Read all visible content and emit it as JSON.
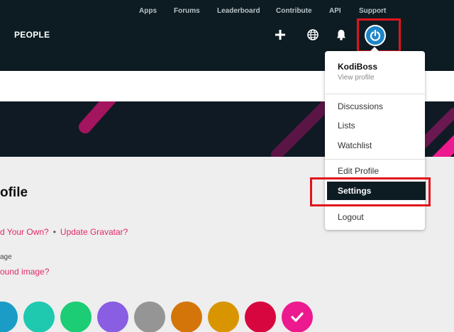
{
  "nav": {
    "links": [
      "Apps",
      "Forums",
      "Leaderboard",
      "Contribute",
      "API",
      "Support"
    ],
    "brand": "PEOPLE",
    "icons": [
      "plus-icon",
      "globe-icon",
      "bell-icon",
      "power-icon"
    ]
  },
  "dropdown": {
    "username": "KodiBoss",
    "view_profile": "View profile",
    "items": [
      "Discussions",
      "Lists",
      "Watchlist"
    ],
    "edit_profile": "Edit Profile",
    "settings": "Settings",
    "logout": "Logout"
  },
  "profile": {
    "heading": "ofile",
    "upload_link": "d Your Own?",
    "separator": "•",
    "gravatar_link": "Update Gravatar?",
    "bg_label": "age",
    "bg_link": "ound image?"
  },
  "swatches": [
    {
      "color": "#1a9cc6",
      "selected": false
    },
    {
      "color": "#1ec9b0",
      "selected": false
    },
    {
      "color": "#1ccd75",
      "selected": false
    },
    {
      "color": "#8a5ee3",
      "selected": false
    },
    {
      "color": "#959595",
      "selected": false
    },
    {
      "color": "#d4750a",
      "selected": false
    },
    {
      "color": "#d99500",
      "selected": false
    },
    {
      "color": "#d8063f",
      "selected": false
    },
    {
      "color": "#ec1a8e",
      "selected": true
    }
  ],
  "colors": {
    "nav_bg": "#0d1c22",
    "accent": "#e0286c",
    "highlight": "#e1141e",
    "avatar": "#1d86c8"
  }
}
